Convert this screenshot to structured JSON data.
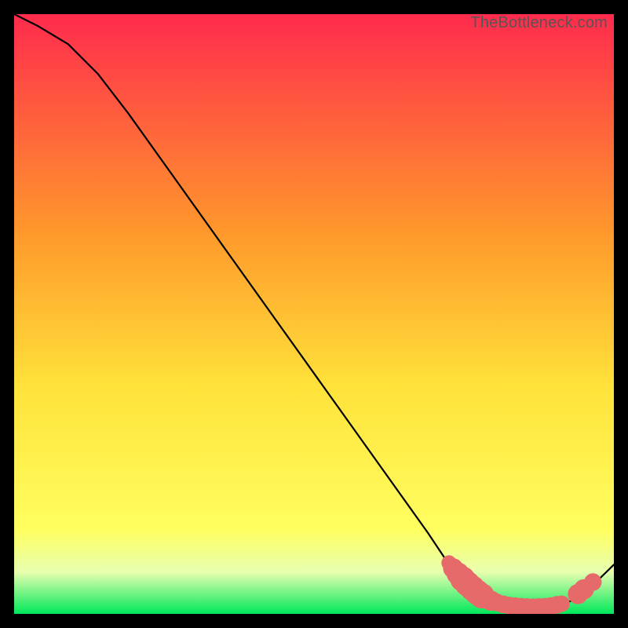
{
  "attribution": "TheBottleneck.com",
  "colors": {
    "gradient_top": "#ff2b4d",
    "gradient_mid1": "#ff9a2b",
    "gradient_mid2": "#ffe23a",
    "gradient_mid3": "#ffff60",
    "gradient_bottom": "#00e85a",
    "curve": "#000000",
    "marker_fill": "#e76a6a",
    "marker_stroke": "#d85a5a"
  },
  "chart_data": {
    "type": "line",
    "title": "",
    "xlabel": "",
    "ylabel": "",
    "xlim": [
      0,
      100
    ],
    "ylim": [
      0,
      100
    ],
    "series": [
      {
        "name": "curve",
        "x": [
          0,
          4,
          9,
          14,
          19,
          24,
          29,
          34,
          39,
          44,
          49,
          54,
          59,
          64,
          69,
          72,
          75,
          78,
          81,
          84,
          87,
          90,
          93,
          96,
          100
        ],
        "y": [
          100,
          98,
          95,
          90,
          83.5,
          76.5,
          69.5,
          62.5,
          55.5,
          48.5,
          41.5,
          34.5,
          27.5,
          20.5,
          13.5,
          9,
          5.5,
          3.2,
          1.9,
          1.2,
          1.1,
          1.3,
          2.2,
          4.3,
          8.2
        ]
      }
    ],
    "markers": [
      {
        "x": 72.5,
        "y": 8.5,
        "r": 1.2
      },
      {
        "x": 73.2,
        "y": 7.6,
        "r": 1.6
      },
      {
        "x": 74.0,
        "y": 6.7,
        "r": 1.8
      },
      {
        "x": 74.8,
        "y": 5.8,
        "r": 2.0
      },
      {
        "x": 75.6,
        "y": 5.0,
        "r": 2.0
      },
      {
        "x": 76.4,
        "y": 4.3,
        "r": 2.0
      },
      {
        "x": 77.2,
        "y": 3.6,
        "r": 2.0
      },
      {
        "x": 78.0,
        "y": 3.0,
        "r": 2.0
      },
      {
        "x": 79.5,
        "y": 2.2,
        "r": 1.6
      },
      {
        "x": 80.5,
        "y": 1.9,
        "r": 1.4
      },
      {
        "x": 81.5,
        "y": 1.6,
        "r": 1.4
      },
      {
        "x": 82.5,
        "y": 1.4,
        "r": 1.4
      },
      {
        "x": 83.5,
        "y": 1.3,
        "r": 1.4
      },
      {
        "x": 84.5,
        "y": 1.2,
        "r": 1.4
      },
      {
        "x": 85.5,
        "y": 1.15,
        "r": 1.4
      },
      {
        "x": 86.5,
        "y": 1.1,
        "r": 1.4
      },
      {
        "x": 87.5,
        "y": 1.15,
        "r": 1.4
      },
      {
        "x": 88.5,
        "y": 1.2,
        "r": 1.4
      },
      {
        "x": 89.5,
        "y": 1.3,
        "r": 1.4
      },
      {
        "x": 90.5,
        "y": 1.5,
        "r": 1.4
      },
      {
        "x": 91.3,
        "y": 1.7,
        "r": 1.3
      },
      {
        "x": 94.0,
        "y": 3.3,
        "r": 1.6
      },
      {
        "x": 95.0,
        "y": 4.1,
        "r": 1.6
      },
      {
        "x": 96.5,
        "y": 5.3,
        "r": 1.4
      }
    ]
  }
}
